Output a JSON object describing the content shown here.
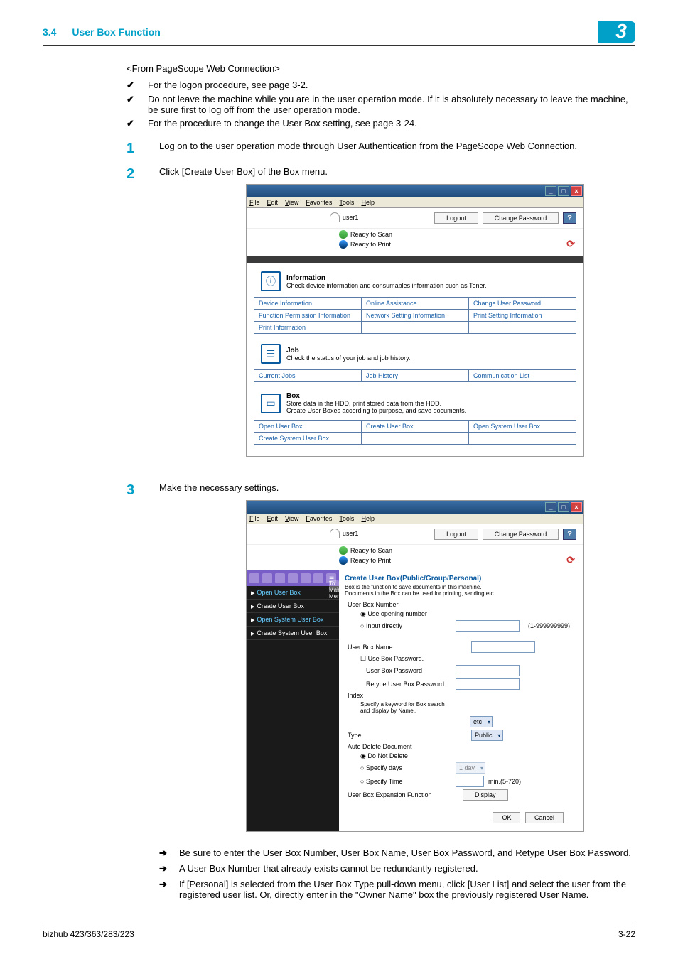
{
  "header": {
    "section_num": "3.4",
    "section_title": "User Box Function",
    "chapter": "3"
  },
  "intro": "<From PageScope Web Connection>",
  "checks": [
    "For the logon procedure, see page 3-2.",
    "Do not leave the machine while you are in the user operation mode. If it is absolutely necessary to leave the machine, be sure first to log off from the user operation mode.",
    "For the procedure to change the User Box setting, see page 3-24."
  ],
  "steps": [
    {
      "n": "1",
      "text": "Log on to the user operation mode through User Authentication from the PageScope Web Connection."
    },
    {
      "n": "2",
      "text": "Click [Create User Box] of the Box menu."
    },
    {
      "n": "3",
      "text": "Make the necessary settings."
    }
  ],
  "shot1": {
    "menu": [
      "File",
      "Edit",
      "View",
      "Favorites",
      "Tools",
      "Help"
    ],
    "user": "user1",
    "logout": "Logout",
    "change_pw": "Change Password",
    "help": "?",
    "status1": "Ready to Scan",
    "status2": "Ready to Print",
    "info": {
      "title": "Information",
      "sub": "Check device information and consumables information such as Toner."
    },
    "info_rows": [
      [
        "Device Information",
        "Online Assistance",
        "Change User Password"
      ],
      [
        "Function Permission Information",
        "Network Setting Information",
        "Print Setting Information"
      ],
      [
        "Print Information",
        "",
        ""
      ]
    ],
    "job": {
      "title": "Job",
      "sub": "Check the status of your job and job history."
    },
    "job_rows": [
      [
        "Current Jobs",
        "Job History",
        "Communication List"
      ]
    ],
    "box": {
      "title": "Box",
      "sub": "Store data in the HDD, print stored data from the HDD.\nCreate User Boxes according to purpose, and save documents."
    },
    "box_rows": [
      [
        "Open User Box",
        "Create User Box",
        "Open System User Box"
      ],
      [
        "Create System User Box",
        "",
        ""
      ]
    ]
  },
  "shot2": {
    "menu": [
      "File",
      "Edit",
      "View",
      "Favorites",
      "Tools",
      "Help"
    ],
    "user": "user1",
    "logout": "Logout",
    "change_pw": "Change Password",
    "status1": "Ready to Scan",
    "status2": "Ready to Print",
    "to_main": "To Main Menu",
    "side": [
      "Open User Box",
      "Create User Box",
      "Open System User Box",
      "Create System User Box"
    ],
    "panel_title": "Create User Box(Public/Group/Personal)",
    "panel_desc": "Box is the function to save documents in this machine.\nDocuments in the Box can be used for printing, sending etc.",
    "l_user_box_number": "User Box Number",
    "r_use_opening": "Use opening number",
    "r_input_direct": "Input directly",
    "num_hint": "(1-999999999)",
    "l_user_box_name": "User Box Name",
    "cb_use_box_pw": "Use Box Password.",
    "l_user_box_pw": "User Box Password",
    "l_retype_pw": "Retype User Box Password",
    "l_index": "Index",
    "index_hint": "Specify a keyword for Box search and display by Name..",
    "index_sel": "etc",
    "l_type": "Type",
    "type_sel": "Public",
    "l_auto_del": "Auto Delete Document",
    "r_do_not_delete": "Do Not Delete",
    "r_specify_days": "Specify days",
    "days_sel": "1 day",
    "r_specify_time": "Specify Time",
    "time_hint": "min.(5-720)",
    "l_expansion": "User Box Expansion Function",
    "btn_display": "Display",
    "btn_ok": "OK",
    "btn_cancel": "Cancel"
  },
  "notes": [
    "Be sure to enter the User Box Number, User Box Name, User Box Password, and Retype User Box Password.",
    "A User Box Number that already exists cannot be redundantly registered.",
    "If [Personal] is selected from the User Box Type pull-down menu, click [User List] and select the user from the registered user list. Or, directly enter in the \"Owner Name\" box the previously registered User Name."
  ],
  "footer": {
    "left": "bizhub 423/363/283/223",
    "right": "3-22"
  }
}
